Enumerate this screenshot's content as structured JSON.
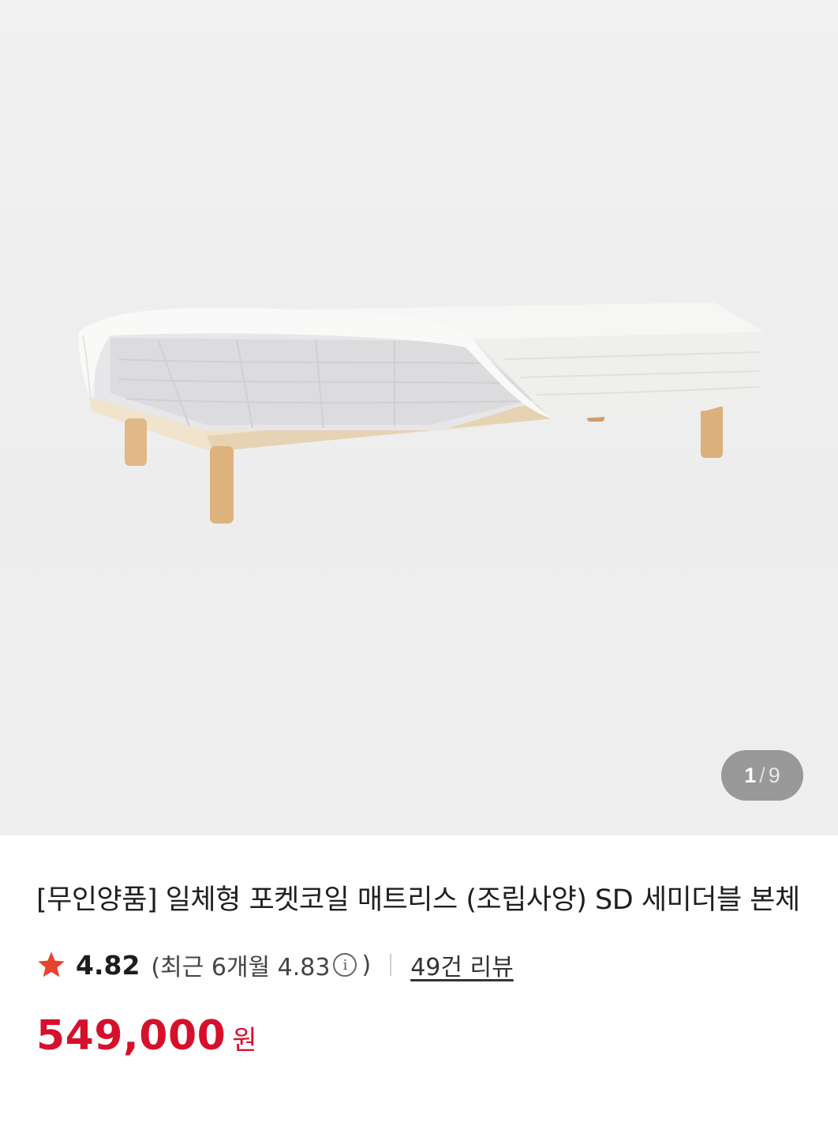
{
  "gallery": {
    "image_alt": "bed with pocket coil mattress",
    "current_index": "1",
    "separator": "/",
    "total": "9"
  },
  "product": {
    "title": "[무인양품] 일체형 포켓코일 매트리스 (조립사양) SD 세미더블 본체"
  },
  "rating": {
    "star_icon": "star-icon",
    "star_color": "#e8412c",
    "score": "4.82",
    "recent_open": "(최근 6개월 4.83",
    "recent_close": ")",
    "info_icon": "info-icon",
    "review_count_label": "49건 리뷰"
  },
  "price": {
    "amount": "549,000",
    "currency": "원",
    "color": "#d6102b"
  }
}
